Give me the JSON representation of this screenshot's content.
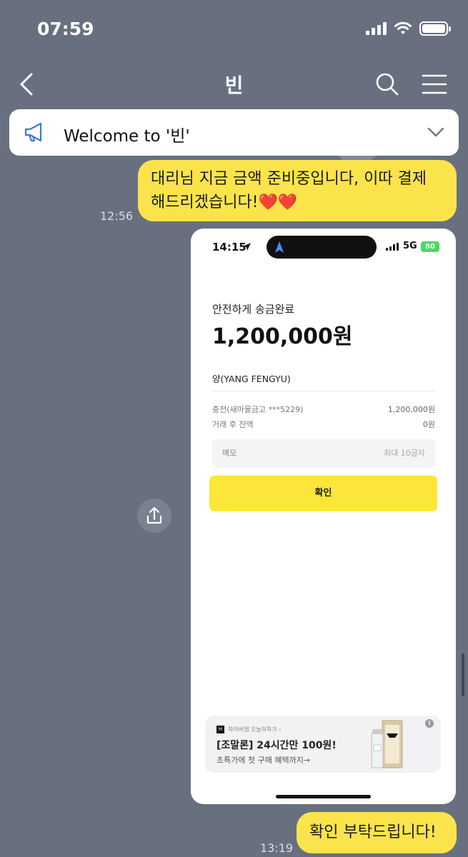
{
  "status_bar": {
    "time": "07:59"
  },
  "header": {
    "title": "빈"
  },
  "notice": {
    "text": "Welcome to '빈'"
  },
  "messages": [
    {
      "text": "대리님 지금 금액 준비중입니다, 이따 결제 해드리겠습니다!❤️❤️",
      "time": "12:56"
    },
    {
      "text": "확인 부탁드립니다!",
      "time": "13:19"
    }
  ],
  "screenshot": {
    "status": {
      "time": "14:15",
      "network": "5G",
      "battery": "80"
    },
    "done_label": "안전하게 송금완료",
    "amount": "1,200,000원",
    "recipient": "양(YANG FENGYU)",
    "rows": [
      {
        "label": "충전(새마을금고 ***5229)",
        "value": "1,200,000원"
      },
      {
        "label": "거래 후 잔액",
        "value": "0원"
      }
    ],
    "memo_label": "메모",
    "memo_hint": "최대 10글자",
    "confirm_label": "확인",
    "ad": {
      "logo": "H",
      "source": "하이버엠 오늘의특가 ›",
      "title": "[조말론] 24시간만 100원!",
      "subtitle": "초특가에 첫 구매 혜택까지→",
      "info": "i"
    }
  }
}
